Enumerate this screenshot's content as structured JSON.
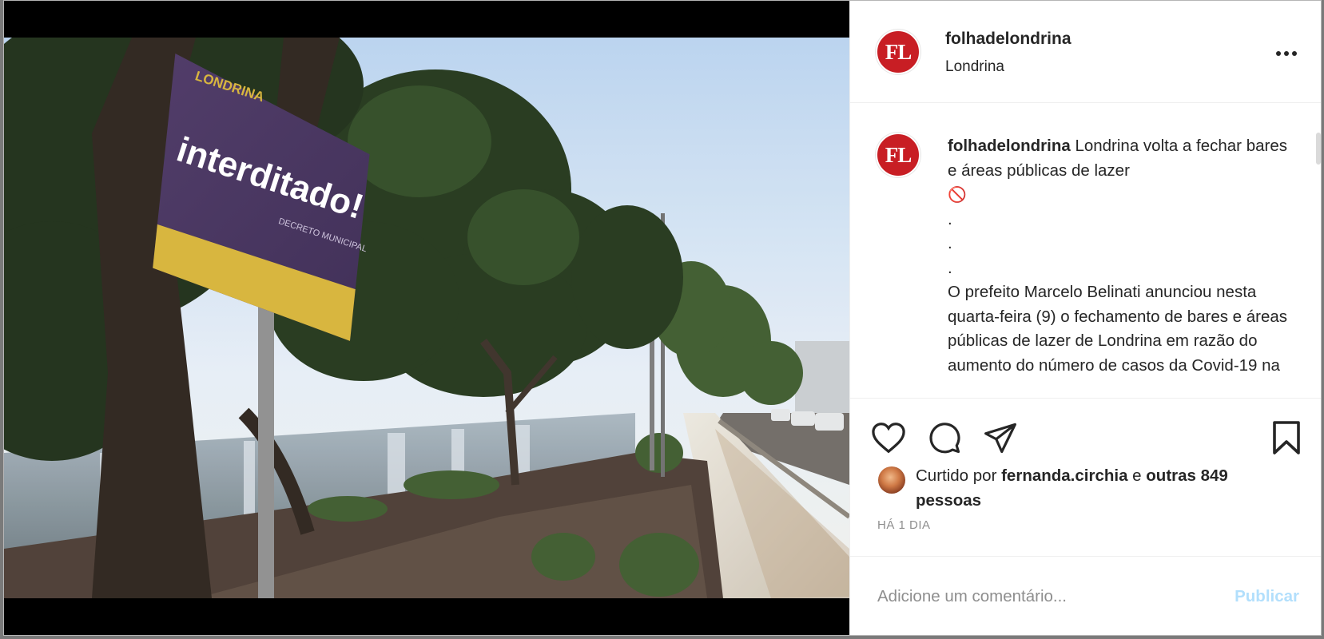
{
  "post": {
    "username": "folhadelondrina",
    "location": "Londrina",
    "avatar_text": "FL",
    "image": {
      "sign_brand": "LONDRINA",
      "sign_title": "interditado!",
      "sign_subtitle": "DECRETO MUNICIPAL"
    }
  },
  "caption": {
    "username": "folhadelondrina",
    "intro": " Londrina volta a fechar bares e áreas públicas de lazer ",
    "intro_icon": "🚫",
    "dots": [
      ".",
      ".",
      "."
    ],
    "body": "O prefeito Marcelo Belinati anunciou nesta quarta-feira (9) o fechamento de bares e áreas públicas de lazer de Londrina em razão do aumento do número de casos da Covid-19 na"
  },
  "actions": {
    "like_icon": "heart-icon",
    "comment_icon": "comment-bubble-icon",
    "share_icon": "paper-plane-icon",
    "save_icon": "bookmark-icon"
  },
  "likes": {
    "prefix": "Curtido por ",
    "user": "fernanda.circhia",
    "middle": " e ",
    "others": "outras 849 pessoas"
  },
  "timestamp": "HÁ 1 DIA",
  "comment_box": {
    "placeholder": "Adicione um comentário...",
    "publish_label": "Publicar"
  },
  "colors": {
    "brand_red": "#c81e24",
    "publish_disabled": "#b2dffc",
    "muted": "#8e8e8e"
  }
}
